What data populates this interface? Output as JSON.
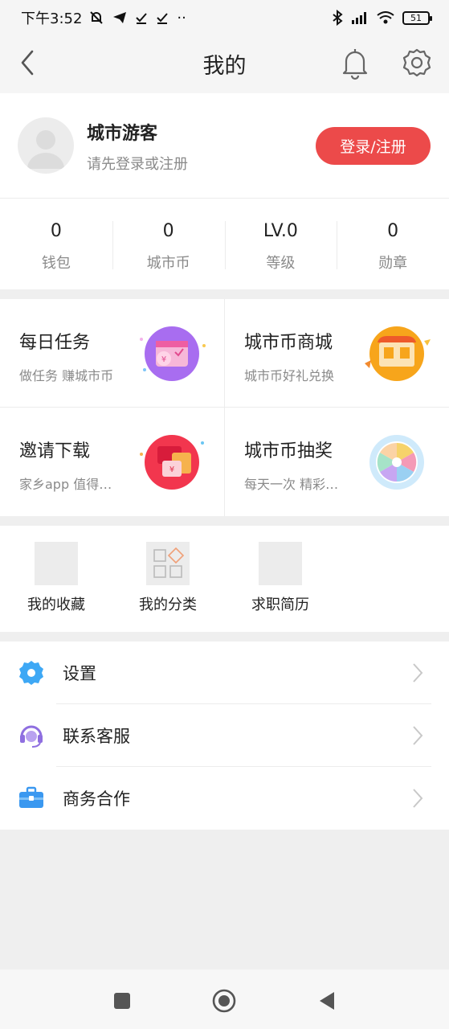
{
  "status_bar": {
    "time": "下午3:52",
    "battery": "51"
  },
  "header": {
    "title": "我的"
  },
  "profile": {
    "name": "城市游客",
    "subtitle": "请先登录或注册",
    "login_button": "登录/注册"
  },
  "stats": [
    {
      "value": "0",
      "label": "钱包"
    },
    {
      "value": "0",
      "label": "城市币"
    },
    {
      "value": "LV.0",
      "label": "等级"
    },
    {
      "value": "0",
      "label": "勋章"
    }
  ],
  "tasks": [
    {
      "title": "每日任务",
      "subtitle": "做任务 赚城市币",
      "icon": "calendar-coin-icon"
    },
    {
      "title": "城市币商城",
      "subtitle": "城市币好礼兑换",
      "icon": "shop-icon"
    },
    {
      "title": "邀请下载",
      "subtitle": "家乡app 值得…",
      "icon": "red-envelope-icon"
    },
    {
      "title": "城市币抽奖",
      "subtitle": "每天一次 精彩…",
      "icon": "lottery-wheel-icon"
    }
  ],
  "shortcuts": [
    {
      "label": "我的收藏"
    },
    {
      "label": "我的分类"
    },
    {
      "label": "求职简历"
    }
  ],
  "menu": [
    {
      "label": "设置",
      "icon": "gear-icon",
      "color": "#3ea8f5"
    },
    {
      "label": "联系客服",
      "icon": "headset-icon",
      "color": "#8f6fe0"
    },
    {
      "label": "商务合作",
      "icon": "briefcase-icon",
      "color": "#3a98f0"
    }
  ],
  "colors": {
    "accent": "#ec4a4a",
    "background": "#efefef"
  }
}
